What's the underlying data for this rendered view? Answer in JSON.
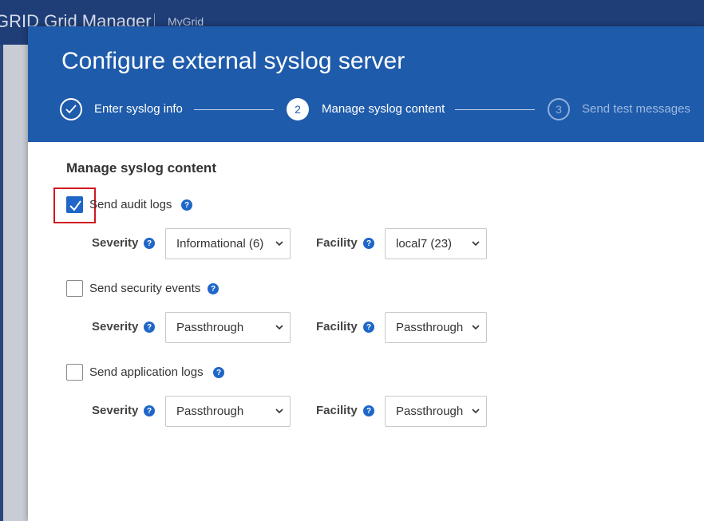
{
  "app": {
    "title": "GRID Grid Manager",
    "grid_name": "MyGrid"
  },
  "modal": {
    "title": "Configure external syslog server",
    "steps": [
      {
        "number": "✓",
        "label": "Enter syslog info",
        "state": "done"
      },
      {
        "number": "2",
        "label": "Manage syslog content",
        "state": "active"
      },
      {
        "number": "3",
        "label": "Send test messages",
        "state": "pending"
      }
    ]
  },
  "section": {
    "title": "Manage syslog content"
  },
  "groups": [
    {
      "label": "Send audit logs",
      "checked": true,
      "severity_label": "Severity",
      "severity": "Informational (6)",
      "facility_label": "Facility",
      "facility": "local7 (23)"
    },
    {
      "label": "Send security events",
      "checked": false,
      "severity_label": "Severity",
      "severity": "Passthrough",
      "facility_label": "Facility",
      "facility": "Passthrough"
    },
    {
      "label": "Send application logs",
      "checked": false,
      "severity_label": "Severity",
      "severity": "Passthrough",
      "facility_label": "Facility",
      "facility": "Passthrough"
    }
  ],
  "help_glyph": "?",
  "colors": {
    "header": "#1f3e78",
    "modal_header": "#1f5bab",
    "accent": "#1f66c8",
    "highlight": "#d0191f"
  }
}
